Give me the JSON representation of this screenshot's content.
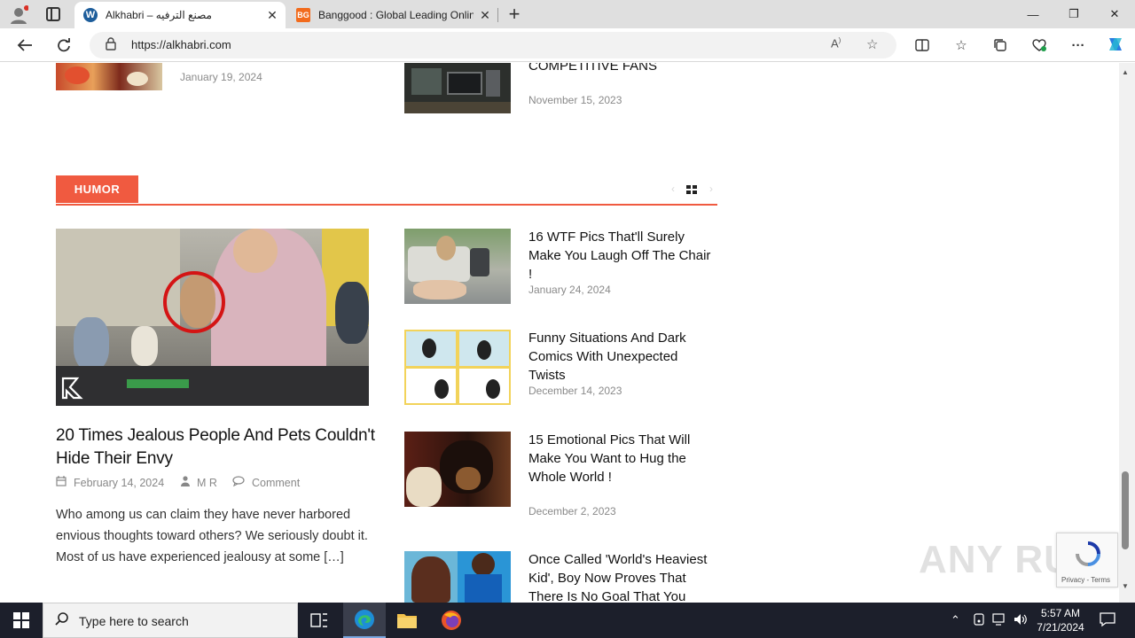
{
  "browser": {
    "tabs": [
      {
        "title": "Alkhabri – مصنع الترفيه",
        "close": "✕"
      },
      {
        "title": "Banggood : Global Leading Onlin",
        "close": "✕",
        "favicon_text": "BG"
      }
    ],
    "new_tab": "+",
    "url": "https://alkhabri.com",
    "window_controls": {
      "minimize": "—",
      "restore": "❐",
      "close": "✕"
    }
  },
  "top_posts": {
    "left": {
      "date": "January 19, 2024"
    },
    "right": {
      "title": "COMPETITIVE FANS",
      "date": "November 15, 2023"
    }
  },
  "humor": {
    "label": "HUMOR",
    "main": {
      "title": "20 Times Jealous People And Pets Couldn't Hide Their Envy",
      "date": "February 14, 2024",
      "author": "M R",
      "comment": "Comment",
      "excerpt": "Who among us can claim they have never harbored envious thoughts toward others? We seriously doubt it. Most of us have experienced jealousy at some",
      "more": "[…]"
    },
    "side_posts": [
      {
        "title": "16 WTF Pics That'll Surely Make You Laugh Off The Chair !",
        "date": "January 24, 2024"
      },
      {
        "title": "Funny Situations And Dark Comics With Unexpected Twists",
        "date": "December 14, 2023"
      },
      {
        "title": "15 Emotional Pics That Will Make You Want to Hug the Whole World !",
        "date": "December 2, 2023"
      },
      {
        "title": "Once Called 'World's Heaviest Kid', Boy Now Proves That There Is No Goal That You Can't",
        "date": ""
      }
    ]
  },
  "recaptcha": {
    "privacy": "Privacy",
    "terms": "Terms"
  },
  "watermark": "ANY RUN",
  "taskbar": {
    "search_placeholder": "Type here to search",
    "time": "5:57 AM",
    "date": "7/21/2024"
  }
}
